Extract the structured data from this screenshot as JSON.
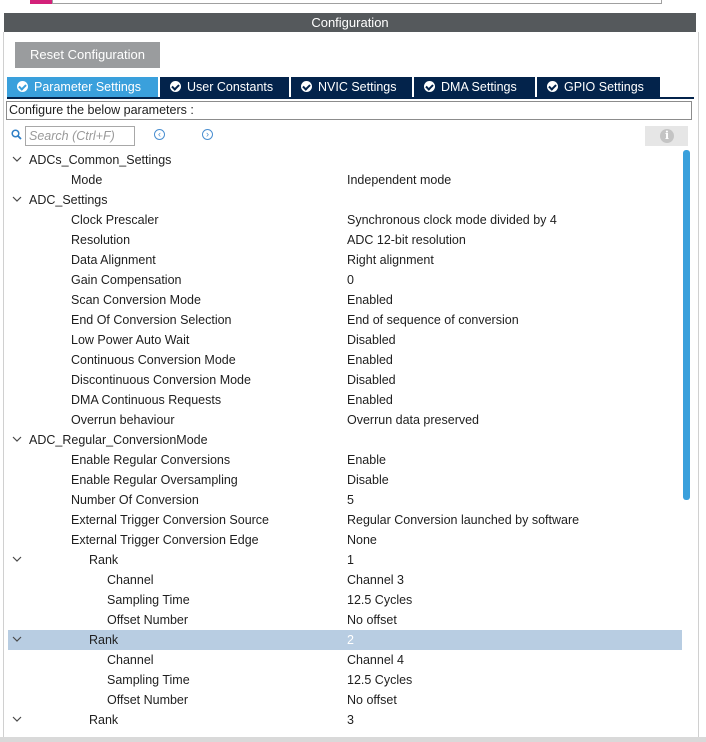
{
  "window": {
    "title": "Configuration"
  },
  "toolbar": {
    "reset_label": "Reset Configuration"
  },
  "tabs": [
    {
      "label": "Parameter Settings",
      "active": true
    },
    {
      "label": "User Constants",
      "active": false
    },
    {
      "label": "NVIC Settings",
      "active": false
    },
    {
      "label": "DMA Settings",
      "active": false
    },
    {
      "label": "GPIO Settings",
      "active": false
    }
  ],
  "configure_text": "Configure the below parameters :",
  "search": {
    "placeholder": "Search (Ctrl+F)"
  },
  "tree": [
    {
      "type": "group",
      "label": "ADCs_Common_Settings"
    },
    {
      "type": "param",
      "label": "Mode",
      "value": "Independent mode"
    },
    {
      "type": "group",
      "label": "ADC_Settings"
    },
    {
      "type": "param",
      "label": "Clock Prescaler",
      "value": "Synchronous clock mode divided by 4"
    },
    {
      "type": "param",
      "label": "Resolution",
      "value": "ADC 12-bit resolution"
    },
    {
      "type": "param",
      "label": "Data Alignment",
      "value": "Right alignment"
    },
    {
      "type": "param",
      "label": "Gain Compensation",
      "value": "0"
    },
    {
      "type": "param",
      "label": "Scan Conversion Mode",
      "value": "Enabled"
    },
    {
      "type": "param",
      "label": "End Of Conversion Selection",
      "value": "End of sequence of conversion"
    },
    {
      "type": "param",
      "label": "Low Power Auto Wait",
      "value": "Disabled"
    },
    {
      "type": "param",
      "label": "Continuous Conversion Mode",
      "value": "Enabled"
    },
    {
      "type": "param",
      "label": "Discontinuous Conversion Mode",
      "value": "Disabled"
    },
    {
      "type": "param",
      "label": "DMA Continuous Requests",
      "value": "Enabled"
    },
    {
      "type": "param",
      "label": "Overrun behaviour",
      "value": "Overrun data preserved"
    },
    {
      "type": "group",
      "label": "ADC_Regular_ConversionMode"
    },
    {
      "type": "param",
      "label": "Enable Regular Conversions",
      "value": "Enable"
    },
    {
      "type": "param",
      "label": "Enable Regular Oversampling",
      "value": "Disable"
    },
    {
      "type": "param",
      "label": "Number Of Conversion",
      "value": "5"
    },
    {
      "type": "param",
      "label": "External Trigger Conversion Source",
      "value": "Regular Conversion launched by software"
    },
    {
      "type": "param",
      "label": "External Trigger Conversion Edge",
      "value": "None"
    },
    {
      "type": "rank",
      "label": "Rank",
      "value": "1"
    },
    {
      "type": "sub",
      "label": "Channel",
      "value": "Channel 3"
    },
    {
      "type": "sub",
      "label": "Sampling Time",
      "value": "12.5 Cycles"
    },
    {
      "type": "sub",
      "label": "Offset Number",
      "value": "No offset"
    },
    {
      "type": "rank",
      "label": "Rank",
      "value": "2",
      "selected": true
    },
    {
      "type": "sub",
      "label": "Channel",
      "value": "Channel 4"
    },
    {
      "type": "sub",
      "label": "Sampling Time",
      "value": "12.5 Cycles"
    },
    {
      "type": "sub",
      "label": "Offset Number",
      "value": "No offset"
    },
    {
      "type": "rank",
      "label": "Rank",
      "value": "3"
    }
  ]
}
